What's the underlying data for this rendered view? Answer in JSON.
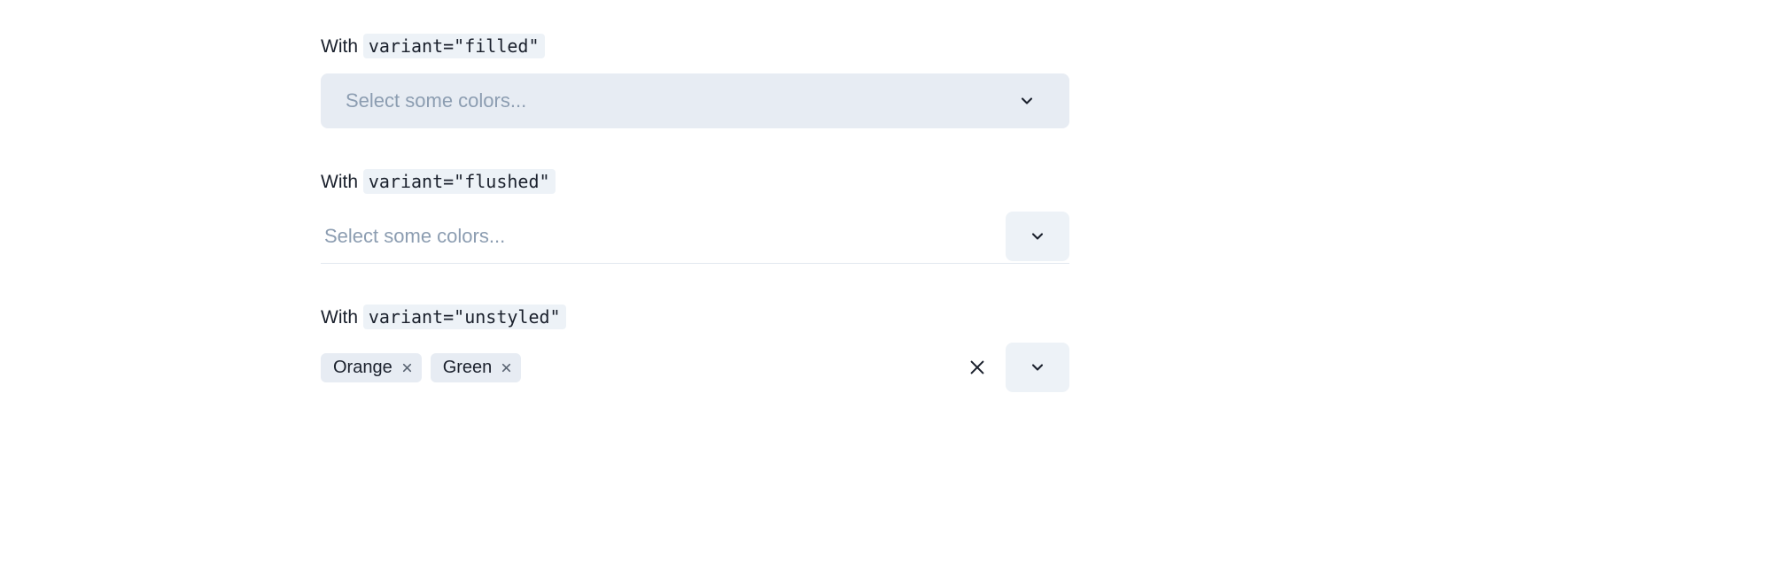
{
  "sections": {
    "filled": {
      "label_prefix": "With ",
      "code": "variant=\"filled\"",
      "placeholder": "Select some colors..."
    },
    "flushed": {
      "label_prefix": "With ",
      "code": "variant=\"flushed\"",
      "placeholder": "Select some colors..."
    },
    "unstyled": {
      "label_prefix": "With ",
      "code": "variant=\"unstyled\"",
      "tags": {
        "0": {
          "label": "Orange"
        },
        "1": {
          "label": "Green"
        }
      }
    }
  }
}
